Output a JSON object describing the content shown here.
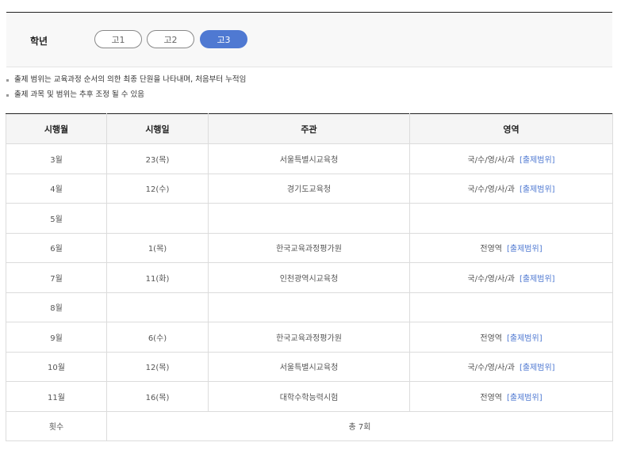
{
  "grade": {
    "label": "학년",
    "options": [
      "고1",
      "고2",
      "고3"
    ],
    "selected": "고3"
  },
  "notes": [
    "출제 범위는 교육과정 순서의 의한 최종 단원을 나타내며, 처음부터 누적임",
    "출제 과목 및 범위는 추후 조정 될 수 있음"
  ],
  "table": {
    "headers": [
      "시행월",
      "시행일",
      "주관",
      "영역"
    ],
    "link_label": "[출제범위]",
    "rows": [
      {
        "month": "3월",
        "date": "23(목)",
        "org": "서울특별시교육청",
        "area": "국/수/영/사/과",
        "link": true
      },
      {
        "month": "4월",
        "date": "12(수)",
        "org": "경기도교육청",
        "area": "국/수/영/사/과",
        "link": true
      },
      {
        "month": "5월",
        "date": "",
        "org": "",
        "area": "",
        "link": false
      },
      {
        "month": "6월",
        "date": "1(목)",
        "org": "한국교육과정평가원",
        "area": "전영역",
        "link": true
      },
      {
        "month": "7월",
        "date": "11(화)",
        "org": "인천광역시교육청",
        "area": "국/수/영/사/과",
        "link": true
      },
      {
        "month": "8월",
        "date": "",
        "org": "",
        "area": "",
        "link": false
      },
      {
        "month": "9월",
        "date": "6(수)",
        "org": "한국교육과정평가원",
        "area": "전영역",
        "link": true
      },
      {
        "month": "10월",
        "date": "12(목)",
        "org": "서울특별시교육청",
        "area": "국/수/영/사/과",
        "link": true
      },
      {
        "month": "11월",
        "date": "16(목)",
        "org": "대학수학능력시험",
        "area": "전영역",
        "link": true
      }
    ],
    "total_label": "횟수",
    "total_value": "총 7회"
  },
  "colors": {
    "accent": "#4f79d2",
    "header_bg": "#f5f5f5",
    "border": "#dcdcdc"
  }
}
